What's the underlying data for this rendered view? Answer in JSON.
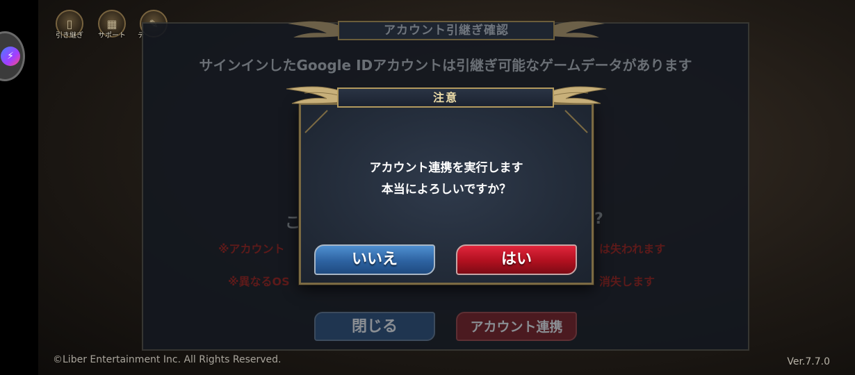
{
  "top_icons": [
    {
      "label": "引き継ぎ",
      "icon": "transfer-icon"
    },
    {
      "label": "サポート",
      "icon": "grid-icon"
    },
    {
      "label": "デ",
      "icon": "data-icon"
    }
  ],
  "background_dialog": {
    "title": "アカウント引継ぎ確認",
    "subtitle": "サインインしたGoogle IDアカウントは引継ぎ可能なゲームデータがあります",
    "question_left": "こ",
    "question_right": "?",
    "warning1_left": "※アカウント",
    "warning1_right": "は失われます",
    "warning2_left": "※異なるOS",
    "warning2_right": "消失します",
    "close_button": "閉じる",
    "link_button": "アカウント連携"
  },
  "modal": {
    "title": "注意",
    "message_line1": "アカウント連携を実行します",
    "message_line2": "本当によろしいですか？",
    "no_button": "いいえ",
    "yes_button": "はい"
  },
  "footer": {
    "copyright": "©Liber Entertainment Inc. All Rights Reserved.",
    "version": "Ver.7.7.0"
  },
  "colors": {
    "no_button": "#2d62a1",
    "yes_button": "#b0101f",
    "gold_border": "#b39a5e"
  }
}
